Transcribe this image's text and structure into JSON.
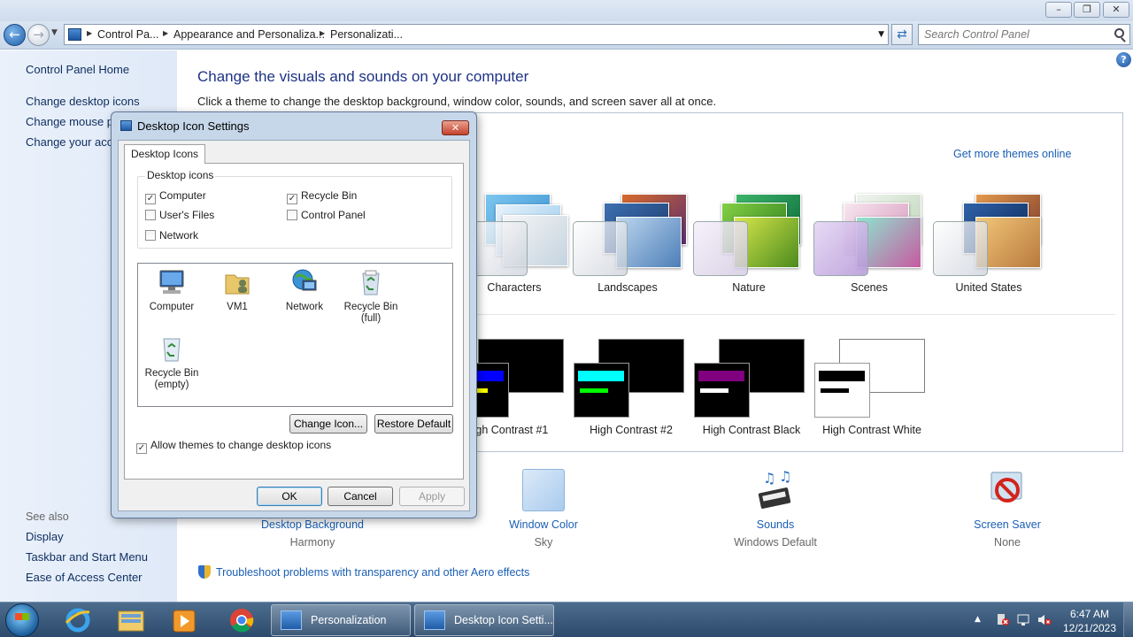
{
  "address": {
    "crumbs": [
      "Control Pa...",
      "Appearance and Personaliza...",
      "Personalizati..."
    ],
    "search_placeholder": "Search Control Panel"
  },
  "sidebar": {
    "home": "Control Panel Home",
    "links": [
      "Change desktop icons",
      "Change mouse po",
      "Change your acco"
    ],
    "see_also_title": "See also",
    "see_also": [
      "Display",
      "Taskbar and Start Menu",
      "Ease of Access Center"
    ]
  },
  "main": {
    "title": "Change the visuals and sounds on your computer",
    "subtitle": "Click a theme to change the desktop background, window color, sounds, and screen saver all at once.",
    "more_themes": "Get more themes online",
    "themes": [
      "Characters",
      "Landscapes",
      "Nature",
      "Scenes",
      "United States"
    ],
    "high_contrast": [
      "igh Contrast #1",
      "High Contrast #2",
      "High Contrast Black",
      "High Contrast White"
    ],
    "bottom": [
      {
        "label": "Desktop Background",
        "value": "Harmony"
      },
      {
        "label": "Window Color",
        "value": "Sky"
      },
      {
        "label": "Sounds",
        "value": "Windows Default"
      },
      {
        "label": "Screen Saver",
        "value": "None"
      }
    ],
    "troubleshoot": "Troubleshoot problems with transparency and other Aero effects",
    "help": "?"
  },
  "dialog": {
    "title": "Desktop Icon Settings",
    "tab": "Desktop Icons",
    "group_title": "Desktop icons",
    "checkboxes": [
      {
        "label": "Computer",
        "checked": true
      },
      {
        "label": "Recycle Bin",
        "checked": true
      },
      {
        "label": "User's Files",
        "checked": false
      },
      {
        "label": "Control Panel",
        "checked": false
      },
      {
        "label": "Network",
        "checked": false
      }
    ],
    "icons": [
      {
        "line1": "Computer",
        "line2": ""
      },
      {
        "line1": "VM1",
        "line2": ""
      },
      {
        "line1": "Network",
        "line2": ""
      },
      {
        "line1": "Recycle Bin",
        "line2": "(full)"
      },
      {
        "line1": "Recycle Bin",
        "line2": "(empty)"
      }
    ],
    "change_icon": "Change Icon...",
    "restore_default": "Restore Default",
    "allow_themes": "Allow themes to change desktop icons",
    "allow_themes_checked": true,
    "ok": "OK",
    "cancel": "Cancel",
    "apply": "Apply"
  },
  "taskbar": {
    "tasks": [
      "Personalization",
      "Desktop Icon Setti..."
    ],
    "time": "6:47 AM",
    "date": "12/21/2023"
  },
  "colors": {
    "link": "#1a5fb4",
    "title": "#1e3287",
    "hc1_bar": "#0000ff",
    "hc2_bar": "#00ffff",
    "hcblack_bar": "#800080"
  }
}
